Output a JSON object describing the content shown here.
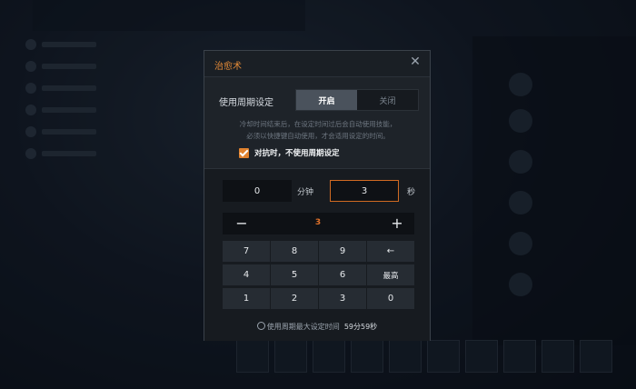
{
  "dialog": {
    "title": "治愈术",
    "close_icon": "close-icon"
  },
  "period": {
    "label": "使用周期设定",
    "on_label": "开启",
    "off_label": "关闭",
    "selected": "on"
  },
  "description": {
    "line1": "冷却时间结束后，在设定时间过后会自动使用技能，",
    "line2": "必须以快捷键自动使用，才会适用设定的时间。"
  },
  "pvp_checkbox": {
    "label": "对抗时，不使用周期设定",
    "checked": true
  },
  "time": {
    "minutes": "0",
    "minutes_unit": "分钟",
    "seconds": "3",
    "seconds_unit": "秒",
    "active_field": "seconds"
  },
  "stepper": {
    "minus": "−",
    "value": "3",
    "plus": "+"
  },
  "keypad": {
    "keys": [
      "7",
      "8",
      "9",
      "←",
      "4",
      "5",
      "6",
      "最高",
      "1",
      "2",
      "3",
      "0"
    ]
  },
  "footer": {
    "label": "使用周期最大设定时间",
    "max_value": "59分59秒"
  },
  "colors": {
    "accent": "#e0822e",
    "panel": "#1e2329",
    "key": "#262c33"
  }
}
